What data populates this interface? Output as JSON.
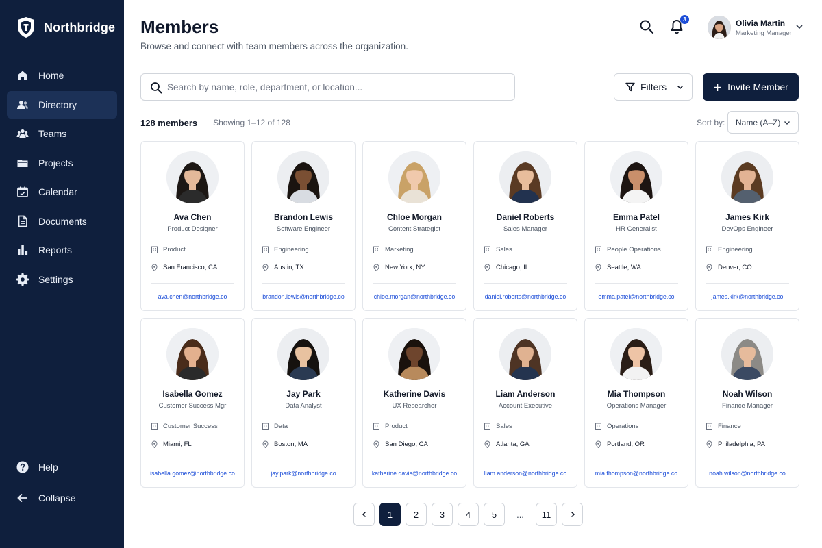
{
  "app": {
    "name": "Northbridge"
  },
  "colors": {
    "sidebar": "#0f1f3d",
    "accent": "#1d4ed8",
    "primary_button": "#0f1f3d"
  },
  "sidebar": {
    "items": [
      {
        "label": "Home",
        "icon": "home-icon",
        "active": false
      },
      {
        "label": "Directory",
        "icon": "users-icon",
        "active": true
      },
      {
        "label": "Teams",
        "icon": "team-icon",
        "active": false
      },
      {
        "label": "Projects",
        "icon": "folder-icon",
        "active": false
      },
      {
        "label": "Calendar",
        "icon": "calendar-icon",
        "active": false
      },
      {
        "label": "Documents",
        "icon": "document-icon",
        "active": false
      },
      {
        "label": "Reports",
        "icon": "bar-chart-icon",
        "active": false
      },
      {
        "label": "Settings",
        "icon": "gear-icon",
        "active": false
      }
    ],
    "bottom": [
      {
        "label": "Help",
        "icon": "help-icon"
      },
      {
        "label": "Collapse",
        "icon": "arrow-left-icon"
      }
    ]
  },
  "header": {
    "title": "Members",
    "subtitle": "Browse and connect with team members across the organization.",
    "notification_count": "3",
    "user": {
      "name": "Olivia Martin",
      "role": "Marketing Manager"
    }
  },
  "toolbar": {
    "search_placeholder": "Search by name, role, department, or location...",
    "filters_label": "Filters",
    "invite_label": "Invite Member"
  },
  "summary": {
    "member_count": "128 members",
    "showing": "Showing 1–12 of 128",
    "sort_label": "Sort by:",
    "sort_value": "Name (A–Z)"
  },
  "members": [
    {
      "name": "Ava Chen",
      "role": "Product Designer",
      "department": "Product",
      "location": "San Francisco, CA",
      "email": "ava.chen@northbridge.co",
      "skin": "#e3b99a",
      "hair": "#1c1714",
      "shirt": "#2b2b2b",
      "bg": "#eef0f3"
    },
    {
      "name": "Brandon Lewis",
      "role": "Software Engineer",
      "department": "Engineering",
      "location": "Austin, TX",
      "email": "brandon.lewis@northbridge.co",
      "skin": "#7a4f33",
      "hair": "#1a1410",
      "shirt": "#d8dce2",
      "bg": "#eceef1"
    },
    {
      "name": "Chloe Morgan",
      "role": "Content Strategist",
      "department": "Marketing",
      "location": "New York, NY",
      "email": "chloe.morgan@northbridge.co",
      "skin": "#f0c9ac",
      "hair": "#c9a267",
      "shirt": "#e9e2d6",
      "bg": "#eef0f3"
    },
    {
      "name": "Daniel Roberts",
      "role": "Sales Manager",
      "department": "Sales",
      "location": "Chicago, IL",
      "email": "daniel.roberts@northbridge.co",
      "skin": "#e8bd9c",
      "hair": "#5a3a24",
      "shirt": "#22324f",
      "bg": "#eceef1"
    },
    {
      "name": "Emma Patel",
      "role": "HR Generalist",
      "department": "People Operations",
      "location": "Seattle, WA",
      "email": "emma.patel@northbridge.co",
      "skin": "#c98f6b",
      "hair": "#1d1512",
      "shirt": "#f4f4f4",
      "bg": "#eef0f3"
    },
    {
      "name": "James Kirk",
      "role": "DevOps Engineer",
      "department": "Engineering",
      "location": "Denver, CO",
      "email": "james.kirk@northbridge.co",
      "skin": "#e2b394",
      "hair": "#5b3b22",
      "shirt": "#54606f",
      "bg": "#eceef1"
    },
    {
      "name": "Isabella Gomez",
      "role": "Customer Success Mgr",
      "department": "Customer Success",
      "location": "Miami, FL",
      "email": "isabella.gomez@northbridge.co",
      "skin": "#e3b08e",
      "hair": "#4a2c1a",
      "shirt": "#2a2a2a",
      "bg": "#eef0f3"
    },
    {
      "name": "Jay Park",
      "role": "Data Analyst",
      "department": "Data",
      "location": "Boston, MA",
      "email": "jay.park@northbridge.co",
      "skin": "#e8c2a0",
      "hair": "#16120f",
      "shirt": "#2a3a52",
      "bg": "#eceef1"
    },
    {
      "name": "Katherine Davis",
      "role": "UX Researcher",
      "department": "Product",
      "location": "San Diego, CA",
      "email": "katherine.davis@northbridge.co",
      "skin": "#6e452d",
      "hair": "#1a120d",
      "shirt": "#b88a5c",
      "bg": "#eef0f3"
    },
    {
      "name": "Liam Anderson",
      "role": "Account Executive",
      "department": "Sales",
      "location": "Atlanta, GA",
      "email": "liam.anderson@northbridge.co",
      "skin": "#e0b291",
      "hair": "#4e3424",
      "shirt": "#24344f",
      "bg": "#eceef1"
    },
    {
      "name": "Mia Thompson",
      "role": "Operations Manager",
      "department": "Operations",
      "location": "Portland, OR",
      "email": "mia.thompson@northbridge.co",
      "skin": "#eec4a6",
      "hair": "#2a1d16",
      "shirt": "#f2f2f2",
      "bg": "#eef0f3"
    },
    {
      "name": "Noah Wilson",
      "role": "Finance Manager",
      "department": "Finance",
      "location": "Philadelphia, PA",
      "email": "noah.wilson@northbridge.co",
      "skin": "#e6bb9c",
      "hair": "#8c8a86",
      "shirt": "#3b4a63",
      "bg": "#eceef1"
    }
  ],
  "pagination": {
    "pages": [
      "1",
      "2",
      "3",
      "4",
      "5"
    ],
    "ellipsis": "...",
    "last": "11",
    "current": "1"
  }
}
